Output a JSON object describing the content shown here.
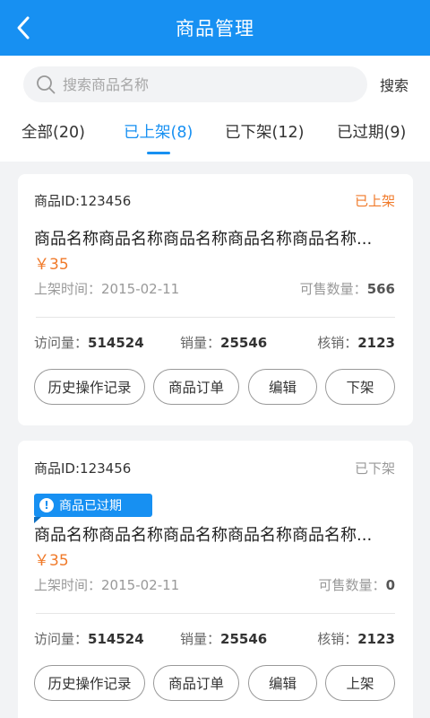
{
  "header": {
    "title": "商品管理"
  },
  "search": {
    "placeholder": "搜索商品名称",
    "button": "搜索"
  },
  "tabs": [
    {
      "label": "全部(20)",
      "active": false
    },
    {
      "label": "已上架(8)",
      "active": true
    },
    {
      "label": "已下架(12)",
      "active": false
    },
    {
      "label": "已过期(9)",
      "active": false
    }
  ],
  "colors": {
    "primary": "#1790f2",
    "accent": "#f07a2a"
  },
  "products": [
    {
      "id": "商品ID:123456",
      "status": "已上架",
      "name": "商品名称商品名称商品名称商品名称商品名称...",
      "price": "￥35",
      "listed_label": "上架时间：",
      "listed_date": "2015-02-11",
      "stock_label": "可售数量：",
      "stock": "566",
      "visits_label": "访问量：",
      "visits": "514524",
      "sales_label": "销量：",
      "sales": "25546",
      "verified_label": "核销：",
      "verified": "2123",
      "buttons": [
        "历史操作记录",
        "商品订单",
        "编辑",
        "下架"
      ]
    },
    {
      "id": "商品ID:123456",
      "status": "已下架",
      "badge": "商品已过期",
      "name": "商品名称商品名称商品名称商品名称商品名称...",
      "price": "￥35",
      "listed_label": "上架时间：",
      "listed_date": "2015-02-11",
      "stock_label": "可售数量：",
      "stock": "0",
      "visits_label": "访问量：",
      "visits": "514524",
      "sales_label": "销量：",
      "sales": "25546",
      "verified_label": "核销：",
      "verified": "2123",
      "buttons": [
        "历史操作记录",
        "商品订单",
        "编辑",
        "上架"
      ]
    }
  ]
}
